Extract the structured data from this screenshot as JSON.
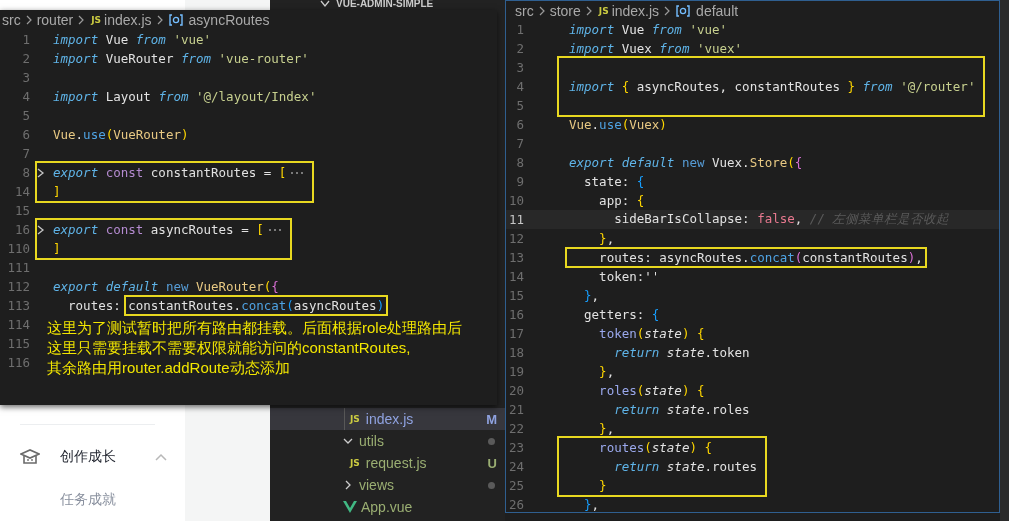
{
  "sidebar": {
    "items": [
      {
        "label": "创作成长",
        "kind": "group",
        "expanded": true
      },
      {
        "label": "任务成就",
        "kind": "sub"
      }
    ]
  },
  "explorer": {
    "title": "VUE-ADMIN-SIMPLE",
    "cut_children": [
      {
        "label": "index.js",
        "kind": "js-file",
        "badge": "JS",
        "status": "M",
        "color": "#8fa2e0",
        "selected": true
      }
    ],
    "items": [
      {
        "label": "utils",
        "kind": "folder",
        "expanded": true,
        "modified": true,
        "color": "#9aae72",
        "selected": false,
        "children": [
          {
            "label": "request.js",
            "kind": "js-file",
            "badge": "JS",
            "status": "U",
            "color": "#9aae72",
            "selected": false
          }
        ]
      },
      {
        "label": "views",
        "kind": "folder",
        "expanded": false,
        "modified": true,
        "color": "#9aae72",
        "selected": false
      },
      {
        "label": "App.vue",
        "kind": "vue-file",
        "color": "#9aae72",
        "selected": false
      }
    ]
  },
  "editors": [
    {
      "breadcrumb": [
        {
          "text": "src",
          "kind": "folder"
        },
        {
          "text": "router",
          "kind": "folder"
        },
        {
          "text": "index.js",
          "kind": "file",
          "badge": "JS"
        },
        {
          "text": "asyncRoutes",
          "kind": "symbol"
        }
      ],
      "lines": [
        {
          "kind": "line",
          "n": "1",
          "code": [
            {
              "text": "import",
              "kind": "kw"
            },
            {
              "text": " Vue ",
              "kind": "id"
            },
            {
              "text": "from",
              "kind": "kw"
            },
            {
              "text": " 'vue'",
              "kind": "str"
            }
          ]
        },
        {
          "kind": "line",
          "n": "2",
          "code": [
            {
              "text": "import",
              "kind": "kw"
            },
            {
              "text": " VueRouter ",
              "kind": "id"
            },
            {
              "text": "from",
              "kind": "kw"
            },
            {
              "text": " 'vue-router'",
              "kind": "str"
            }
          ]
        },
        {
          "kind": "line",
          "n": "3"
        },
        {
          "kind": "line",
          "n": "4",
          "code": [
            {
              "text": "import",
              "kind": "kw"
            },
            {
              "text": " Layout ",
              "kind": "id"
            },
            {
              "text": "from",
              "kind": "kw"
            },
            {
              "text": " '@/layout/Index'",
              "kind": "str"
            }
          ]
        },
        {
          "kind": "line",
          "n": "5"
        },
        {
          "kind": "line",
          "n": "6",
          "code": [
            {
              "text": "Vue",
              "kind": "cls"
            },
            {
              "text": ".",
              "kind": "id"
            },
            {
              "text": "use",
              "kind": "fn"
            },
            {
              "text": "(",
              "kind": "b1"
            },
            {
              "text": "VueRouter",
              "kind": "cls"
            },
            {
              "text": ")",
              "kind": "b1"
            }
          ]
        },
        {
          "kind": "line",
          "n": "7"
        },
        {
          "kind": "box",
          "lines": [
            {
              "kind": "line",
              "n": "8",
              "folded": true,
              "code": [
                {
                  "text": "export",
                  "kind": "kw"
                },
                {
                  "text": " const",
                  "kind": "kw2"
                },
                {
                  "text": " constantRoutes = ",
                  "kind": "id"
                },
                {
                  "text": "[",
                  "kind": "b1"
                }
              ]
            },
            {
              "kind": "line",
              "n": "14",
              "folded": false,
              "code": [
                {
                  "text": "]",
                  "kind": "b1"
                }
              ]
            }
          ]
        },
        {
          "kind": "line",
          "n": "15"
        },
        {
          "kind": "box",
          "lines": [
            {
              "kind": "line",
              "n": "16",
              "folded": true,
              "code": [
                {
                  "text": "export",
                  "kind": "kw"
                },
                {
                  "text": " const",
                  "kind": "kw2"
                },
                {
                  "text": " asyncRoutes = ",
                  "kind": "id"
                },
                {
                  "text": "[",
                  "kind": "b1"
                }
              ]
            },
            {
              "kind": "line",
              "n": "110",
              "folded": false,
              "code": [
                {
                  "text": "]",
                  "kind": "b1"
                }
              ]
            }
          ]
        },
        {
          "kind": "line",
          "n": "111"
        },
        {
          "kind": "line",
          "n": "112",
          "code": [
            {
              "text": "export",
              "kind": "kw"
            },
            {
              "text": " default",
              "kind": "kw"
            },
            {
              "text": " new",
              "kind": "kw3"
            },
            {
              "text": " VueRouter",
              "kind": "cls"
            },
            {
              "text": "(",
              "kind": "b1"
            },
            {
              "text": "{",
              "kind": "b2"
            }
          ]
        },
        {
          "kind": "line",
          "n": "113",
          "code": [
            {
              "text": "  routes: ",
              "kind": "id"
            },
            {
              "kind": "box",
              "tokens": [
                {
                  "text": "constantRoutes.",
                  "kind": "id"
                },
                {
                  "text": "concat",
                  "kind": "fn"
                },
                {
                  "text": "(",
                  "kind": "b3"
                },
                {
                  "text": "asyncRoutes",
                  "kind": "id"
                },
                {
                  "text": ")",
                  "kind": "b3"
                }
              ]
            }
          ]
        },
        {
          "kind": "line",
          "n": "114"
        },
        {
          "kind": "line",
          "n": "115"
        },
        {
          "kind": "line",
          "n": "116"
        }
      ],
      "note": [
        "这里为了测试暂时把所有路由都挂载。后面根据role处理路由后",
        "这里只需要挂载不需要权限就能访问的constantRoutes,",
        "其余路由用router.addRoute动态添加"
      ]
    },
    {
      "breadcrumb": [
        {
          "text": "src",
          "kind": "folder"
        },
        {
          "text": "store",
          "kind": "folder"
        },
        {
          "text": "index.js",
          "kind": "file",
          "badge": "JS"
        },
        {
          "text": "default",
          "kind": "symbol"
        }
      ],
      "lines": [
        {
          "kind": "line",
          "n": "1",
          "current": false,
          "code": [
            {
              "text": "import",
              "kind": "kw"
            },
            {
              "text": " Vue ",
              "kind": "id"
            },
            {
              "text": "from",
              "kind": "kw"
            },
            {
              "text": " 'vue'",
              "kind": "str"
            }
          ]
        },
        {
          "kind": "line",
          "n": "2",
          "current": false,
          "code": [
            {
              "text": "import",
              "kind": "kw"
            },
            {
              "text": " Vuex ",
              "kind": "id"
            },
            {
              "text": "from",
              "kind": "kw"
            },
            {
              "text": " 'vuex'",
              "kind": "str"
            }
          ]
        },
        {
          "kind": "box",
          "lines": [
            {
              "kind": "line",
              "n": "3"
            },
            {
              "kind": "line",
              "n": "4",
              "code": [
                {
                  "text": "import",
                  "kind": "kw"
                },
                {
                  "text": " {",
                  "kind": "b1"
                },
                {
                  "text": " asyncRoutes, constantRoutes ",
                  "kind": "id"
                },
                {
                  "text": "}",
                  "kind": "b1"
                },
                {
                  "text": " from",
                  "kind": "kw"
                },
                {
                  "text": " '@/router'",
                  "kind": "str"
                }
              ]
            },
            {
              "kind": "line",
              "n": "5"
            }
          ]
        },
        {
          "kind": "line",
          "n": "6",
          "current": false,
          "code": [
            {
              "text": "Vue",
              "kind": "cls"
            },
            {
              "text": ".",
              "kind": "id"
            },
            {
              "text": "use",
              "kind": "fn"
            },
            {
              "text": "(",
              "kind": "b1"
            },
            {
              "text": "Vuex",
              "kind": "cls"
            },
            {
              "text": ")",
              "kind": "b1"
            }
          ]
        },
        {
          "kind": "line",
          "n": "7",
          "current": false
        },
        {
          "kind": "line",
          "n": "8",
          "current": false,
          "code": [
            {
              "text": "export",
              "kind": "kw"
            },
            {
              "text": " default",
              "kind": "kw"
            },
            {
              "text": " new",
              "kind": "kw3"
            },
            {
              "text": " Vuex.",
              "kind": "id"
            },
            {
              "text": "Store",
              "kind": "cls"
            },
            {
              "text": "(",
              "kind": "b1"
            },
            {
              "text": "{",
              "kind": "b2"
            }
          ]
        },
        {
          "kind": "line",
          "n": "9",
          "current": false,
          "code": [
            {
              "text": "  state: ",
              "kind": "id"
            },
            {
              "text": "{",
              "kind": "b3"
            }
          ]
        },
        {
          "kind": "line",
          "n": "10",
          "current": false,
          "code": [
            {
              "text": "    app: ",
              "kind": "id"
            },
            {
              "text": "{",
              "kind": "b1"
            }
          ]
        },
        {
          "kind": "line",
          "n": "11",
          "current": true,
          "code": [
            {
              "text": "      sideBarIsCollapse: ",
              "kind": "id"
            },
            {
              "text": "false",
              "kind": "bool"
            },
            {
              "text": ", ",
              "kind": "id"
            },
            {
              "text": "// 左侧菜单栏是否收起",
              "kind": "comment"
            }
          ]
        },
        {
          "kind": "line",
          "n": "12",
          "current": false,
          "code": [
            {
              "text": "    }",
              "kind": "b1"
            },
            {
              "text": ",",
              "kind": "id"
            }
          ]
        },
        {
          "kind": "line",
          "n": "13",
          "current": false,
          "code": [
            {
              "kind": "box",
              "tokens": [
                {
                  "text": "    routes: asyncRoutes.",
                  "kind": "id"
                },
                {
                  "text": "concat",
                  "kind": "fn"
                },
                {
                  "text": "(",
                  "kind": "b2"
                },
                {
                  "text": "constantRoutes",
                  "kind": "id"
                },
                {
                  "text": ")",
                  "kind": "b2"
                },
                {
                  "text": ",",
                  "kind": "id"
                }
              ]
            }
          ]
        },
        {
          "kind": "line",
          "n": "14",
          "current": false,
          "code": [
            {
              "text": "    token:''",
              "kind": "id"
            }
          ]
        },
        {
          "kind": "line",
          "n": "15",
          "current": false,
          "code": [
            {
              "text": "  }",
              "kind": "b3"
            },
            {
              "text": ",",
              "kind": "id"
            }
          ]
        },
        {
          "kind": "line",
          "n": "16",
          "current": false,
          "code": [
            {
              "text": "  getters: ",
              "kind": "id"
            },
            {
              "text": "{",
              "kind": "b3"
            }
          ]
        },
        {
          "kind": "line",
          "n": "17",
          "current": false,
          "code": [
            {
              "text": "    token",
              "kind": "method"
            },
            {
              "text": "(",
              "kind": "b1"
            },
            {
              "text": "state",
              "kind": "param"
            },
            {
              "text": ")",
              "kind": "b1"
            },
            {
              "text": " {",
              "kind": "b1"
            }
          ]
        },
        {
          "kind": "line",
          "n": "18",
          "current": false,
          "code": [
            {
              "text": "      return",
              "kind": "kw"
            },
            {
              "text": " state",
              "kind": "param"
            },
            {
              "text": ".token",
              "kind": "id"
            }
          ]
        },
        {
          "kind": "line",
          "n": "19",
          "current": false,
          "code": [
            {
              "text": "    }",
              "kind": "b1"
            },
            {
              "text": ",",
              "kind": "id"
            }
          ]
        },
        {
          "kind": "line",
          "n": "20",
          "current": false,
          "code": [
            {
              "text": "    roles",
              "kind": "method"
            },
            {
              "text": "(",
              "kind": "b1"
            },
            {
              "text": "state",
              "kind": "param"
            },
            {
              "text": ")",
              "kind": "b1"
            },
            {
              "text": " {",
              "kind": "b1"
            }
          ]
        },
        {
          "kind": "line",
          "n": "21",
          "current": false,
          "code": [
            {
              "text": "      return",
              "kind": "kw"
            },
            {
              "text": " state",
              "kind": "param"
            },
            {
              "text": ".roles",
              "kind": "id"
            }
          ]
        },
        {
          "kind": "line",
          "n": "22",
          "current": false,
          "code": [
            {
              "text": "    }",
              "kind": "b1"
            },
            {
              "text": ",",
              "kind": "id"
            }
          ]
        },
        {
          "kind": "box",
          "lines": [
            {
              "kind": "line",
              "n": "23",
              "code": [
                {
                  "text": "    routes",
                  "kind": "method"
                },
                {
                  "text": "(",
                  "kind": "b1"
                },
                {
                  "text": "state",
                  "kind": "param"
                },
                {
                  "text": ")",
                  "kind": "b1"
                },
                {
                  "text": " {",
                  "kind": "b1"
                }
              ]
            },
            {
              "kind": "line",
              "n": "24",
              "code": [
                {
                  "text": "      return",
                  "kind": "kw"
                },
                {
                  "text": " state",
                  "kind": "param"
                },
                {
                  "text": ".routes",
                  "kind": "id"
                }
              ]
            },
            {
              "kind": "line",
              "n": "25",
              "code": [
                {
                  "text": "    }",
                  "kind": "b1"
                }
              ]
            }
          ]
        },
        {
          "kind": "line",
          "n": "26",
          "current": false,
          "code": [
            {
              "text": "  }",
              "kind": "b3"
            },
            {
              "text": ",",
              "kind": "id"
            }
          ]
        }
      ]
    }
  ]
}
